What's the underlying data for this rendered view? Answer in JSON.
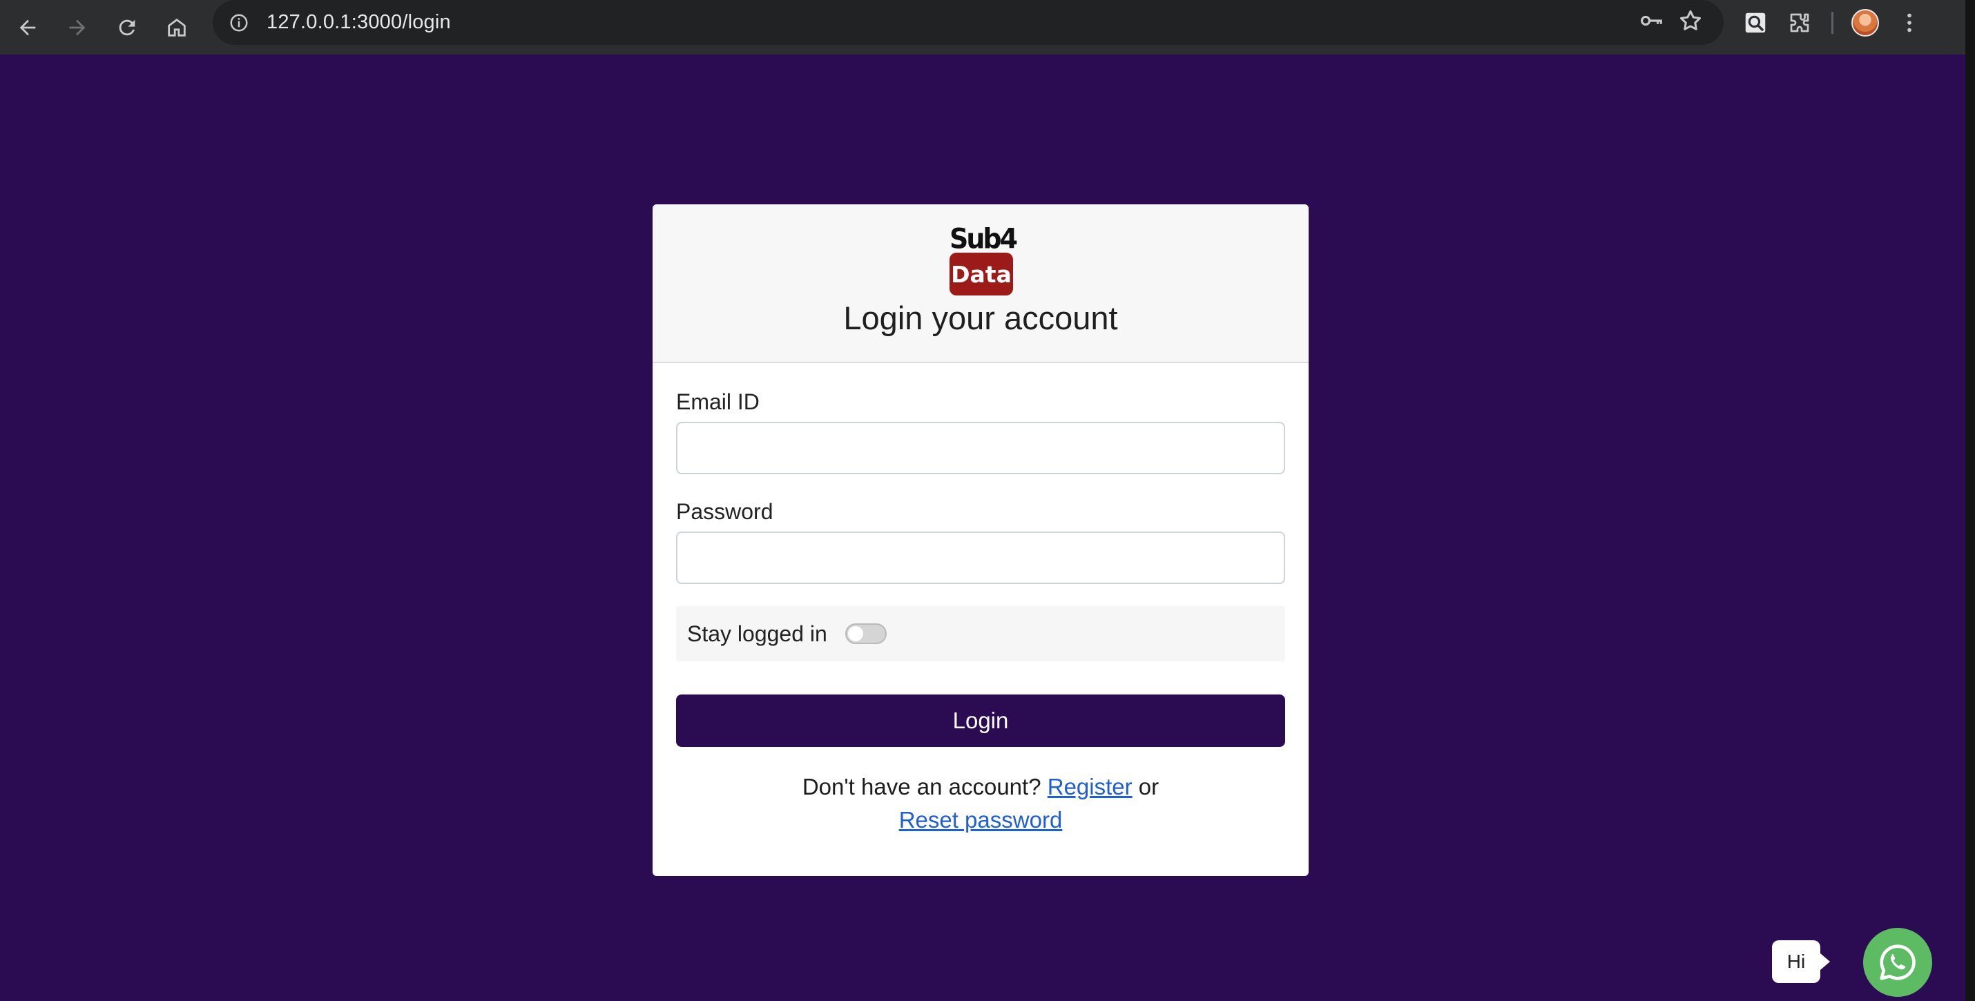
{
  "browser": {
    "url": "127.0.0.1:3000/login"
  },
  "card": {
    "logo": {
      "top_text": "Sub4",
      "box_text": "Data"
    },
    "title": "Login your account",
    "email": {
      "label": "Email ID",
      "value": "",
      "placeholder": ""
    },
    "password": {
      "label": "Password",
      "value": "",
      "placeholder": ""
    },
    "stay_logged_in": {
      "label": "Stay logged in",
      "checked": false
    },
    "login_button": "Login",
    "footer": {
      "prompt": "Don't have an account?",
      "register_link": "Register",
      "or_text": "or",
      "reset_link": "Reset password"
    }
  },
  "chat_widget": {
    "bubble_text": "Hi",
    "icon": "whatsapp-icon",
    "color": "#5dbb63"
  },
  "colors": {
    "page_background": "#2b0b52",
    "button": "#2b0b52",
    "link": "#1f5ed6",
    "logo_box": "#9c1b18"
  }
}
